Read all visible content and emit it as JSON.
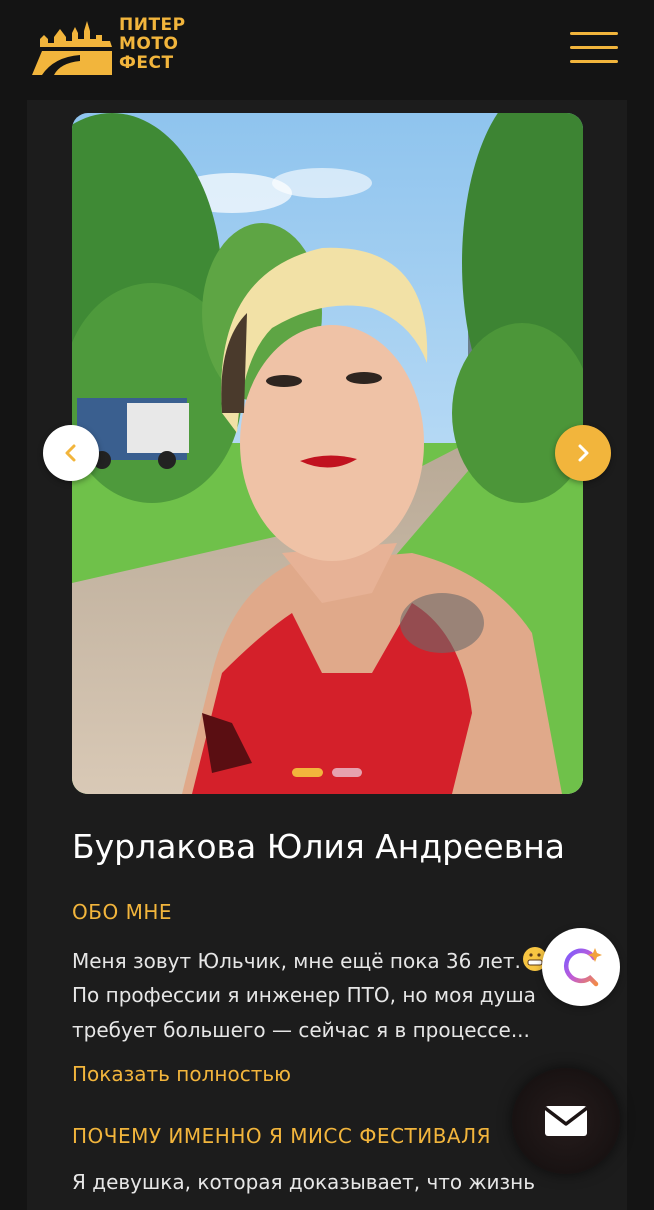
{
  "header": {
    "logo_lines": [
      "ПИТЕР",
      "МОТО",
      "ФЕСТ"
    ]
  },
  "profile": {
    "name": "Бурлакова Юлия Андреевна",
    "about_title": "ОБО МНЕ",
    "about_lines": [
      "Меня зовут Юльчик, мне ещё пока 36 лет.",
      "По профессии я инженер ПТО, но моя душа",
      "требует большего — сейчас я в процессе..."
    ],
    "show_more": "Показать полностью",
    "why_title": "ПОЧЕМУ ИМЕННО Я МИСС ФЕСТИВАЛЯ",
    "why_line": "Я девушка, которая доказывает, что жизнь"
  },
  "carousel": {
    "current": 1,
    "total": 2
  },
  "icons": {
    "menu": "hamburger-menu-icon",
    "prev": "chevron-left-icon",
    "next": "chevron-right-icon",
    "ai": "ai-assistant-icon",
    "mail": "mail-icon",
    "emoji": "grinning-face-emoji"
  },
  "colors": {
    "accent": "#f2b53c",
    "background": "#141414",
    "card": "#1c1c1c",
    "text": "#e6e6e6"
  }
}
